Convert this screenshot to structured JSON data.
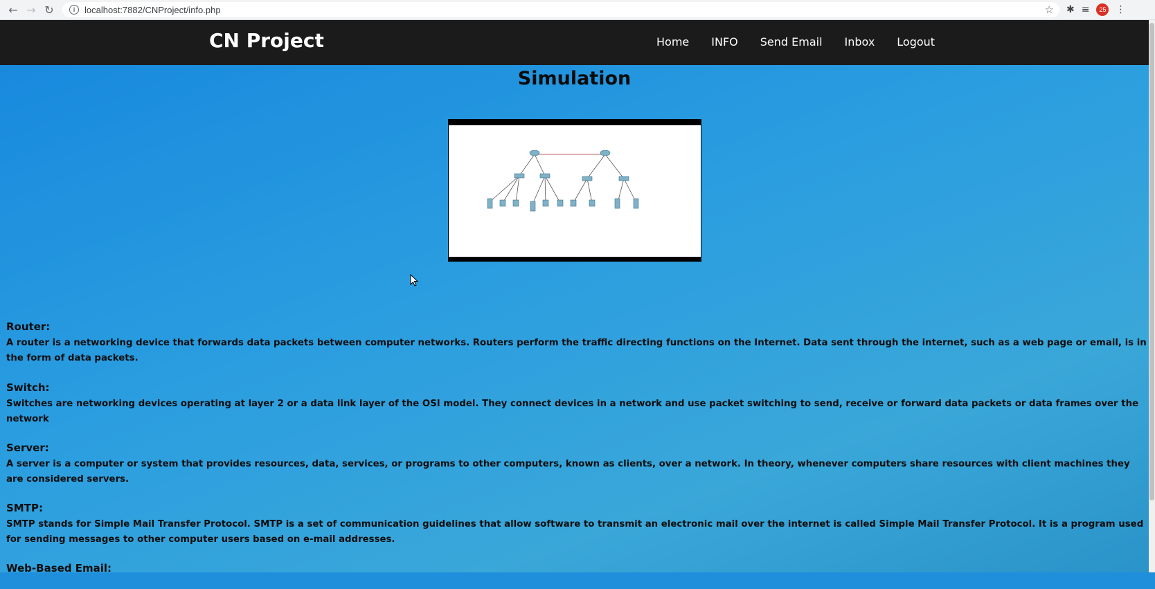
{
  "browser": {
    "url": "localhost:7882/CNProject/info.php",
    "profile_badge": "25"
  },
  "nav": {
    "brand": "CN Project",
    "items": [
      "Home",
      "INFO",
      "Send Email",
      "Inbox",
      "Logout"
    ]
  },
  "simulation": {
    "title": "Simulation"
  },
  "sections": [
    {
      "heading": "Router:",
      "text": "A router is a networking device that forwards data packets between computer networks. Routers perform the traffic directing functions on the Internet. Data sent through the internet, such as a web page or email, is in the form of data packets."
    },
    {
      "heading": "Switch:",
      "text": "Switches are networking devices operating at layer 2 or a data link layer of the OSI model. They connect devices in a network and use packet switching to send, receive or forward data packets or data frames over the network"
    },
    {
      "heading": "Server:",
      "text": "A server is a computer or system that provides resources, data, services, or programs to other computers, known as clients, over a network. In theory, whenever computers share resources with client machines they are considered servers."
    },
    {
      "heading": "SMTP:",
      "text": "SMTP stands for Simple Mail Transfer Protocol. SMTP is a set of communication guidelines that allow software to transmit an electronic mail over the internet is called Simple Mail Transfer Protocol. It is a program used for sending messages to other computer users based on e-mail addresses."
    },
    {
      "heading": "Web-Based Email:",
      "text": ""
    }
  ]
}
